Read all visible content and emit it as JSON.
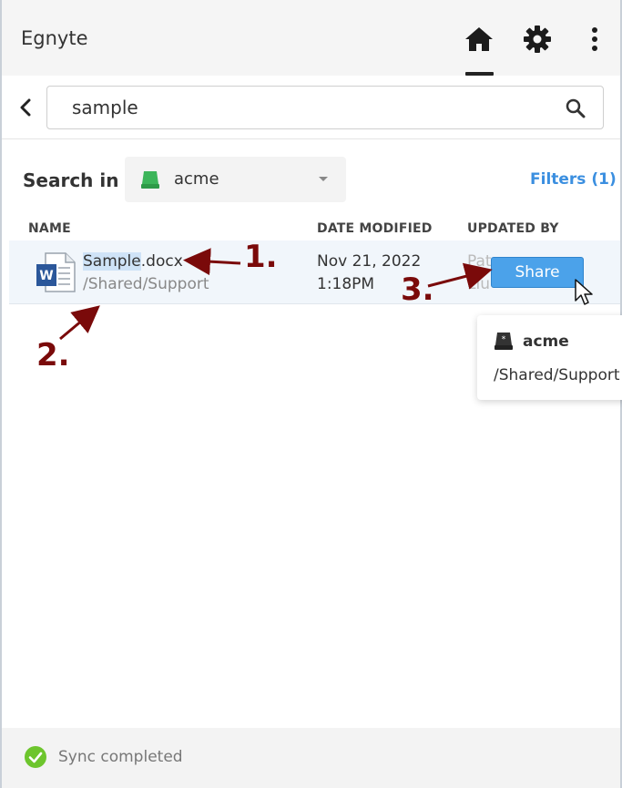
{
  "header": {
    "app_title": "Egnyte",
    "icons": [
      "home-icon",
      "gear-icon",
      "more-vertical-icon"
    ]
  },
  "search": {
    "value": "sample",
    "icon": "search-icon",
    "back_icon": "chevron-left-icon"
  },
  "search_in": {
    "label": "Search in",
    "location": "acme",
    "location_icon_color": "#3cb55a",
    "filters_label": "Filters (1)"
  },
  "table": {
    "columns": [
      "NAME",
      "DATE MODIFIED",
      "UPDATED BY"
    ],
    "rows": [
      {
        "name_highlight": "Sample",
        "name_rest": ".docx",
        "path": "/Shared/Support",
        "date": "Nov 21, 2022",
        "time": "1:18PM",
        "updated_by_line1": "Pat",
        "updated_by_line2": "Liu",
        "share_label": "Share"
      }
    ]
  },
  "tooltip": {
    "title": "acme",
    "path": "/Shared/Support"
  },
  "annotations": [
    "1.",
    "2.",
    "3."
  ],
  "footer": {
    "sync_text": "Sync completed",
    "sync_icon_color": "#6dc52d"
  },
  "colors": {
    "accent": "#3b8fe0",
    "share_button": "#4ba2ea",
    "annotation": "#7a0a0a"
  }
}
